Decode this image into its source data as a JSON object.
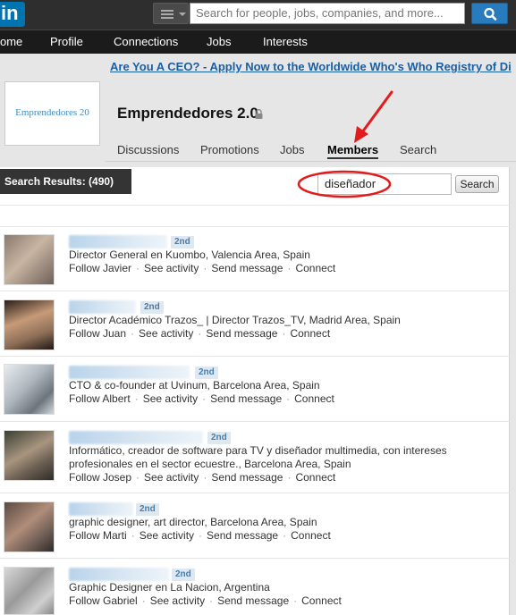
{
  "topbar": {
    "logo_text": "in",
    "search_placeholder": "Search for people, jobs, companies, and more...",
    "search_icon": "search-icon"
  },
  "nav": [
    "ome",
    "Profile",
    "Connections",
    "Jobs",
    "Interests"
  ],
  "ad_text": "Are You A CEO? - Apply Now to the Worldwide Who's Who Registry of Di",
  "group": {
    "logo_text": "Emprendedores 20",
    "name": "Emprendedores 2.0",
    "lock_icon": "lock-icon",
    "tabs": [
      "Discussions",
      "Promotions",
      "Jobs",
      "Members",
      "Search"
    ],
    "active_tab": "Members"
  },
  "results": {
    "label": "Search Results: (490)",
    "query": "diseñador",
    "search_button": "Search"
  },
  "members": [
    {
      "degree": "2nd",
      "headline": "Director General en Kuombo, Valencia Area, Spain",
      "actions": [
        "Follow Javier",
        "See activity",
        "Send message",
        "Connect"
      ]
    },
    {
      "degree": "2nd",
      "headline": "Director Académico Trazos_ | Director Trazos_TV, Madrid Area, Spain",
      "actions": [
        "Follow Juan",
        "See activity",
        "Send message",
        "Connect"
      ]
    },
    {
      "degree": "2nd",
      "headline": "CTO & co-founder at Uvinum, Barcelona Area, Spain",
      "actions": [
        "Follow Albert",
        "See activity",
        "Send message",
        "Connect"
      ]
    },
    {
      "degree": "2nd",
      "headline": "Informático, creador de software para TV y diseñador multimedia, con intereses profesionales en el sector ecuestre., Barcelona Area, Spain",
      "actions": [
        "Follow Josep",
        "See activity",
        "Send message",
        "Connect"
      ]
    },
    {
      "degree": "2nd",
      "headline": "graphic designer, art director, Barcelona Area, Spain",
      "actions": [
        "Follow Marti",
        "See activity",
        "Send message",
        "Connect"
      ]
    },
    {
      "degree": "2nd",
      "headline": "Graphic Designer en La Nacion, Argentina",
      "actions": [
        "Follow Gabriel",
        "See activity",
        "Send message",
        "Connect"
      ]
    }
  ],
  "colors": {
    "topbar": "#2e2e2e",
    "navbar": "#1b1b1b",
    "link_blue": "#1b5fa3",
    "annotation_red": "#e31b1b"
  }
}
